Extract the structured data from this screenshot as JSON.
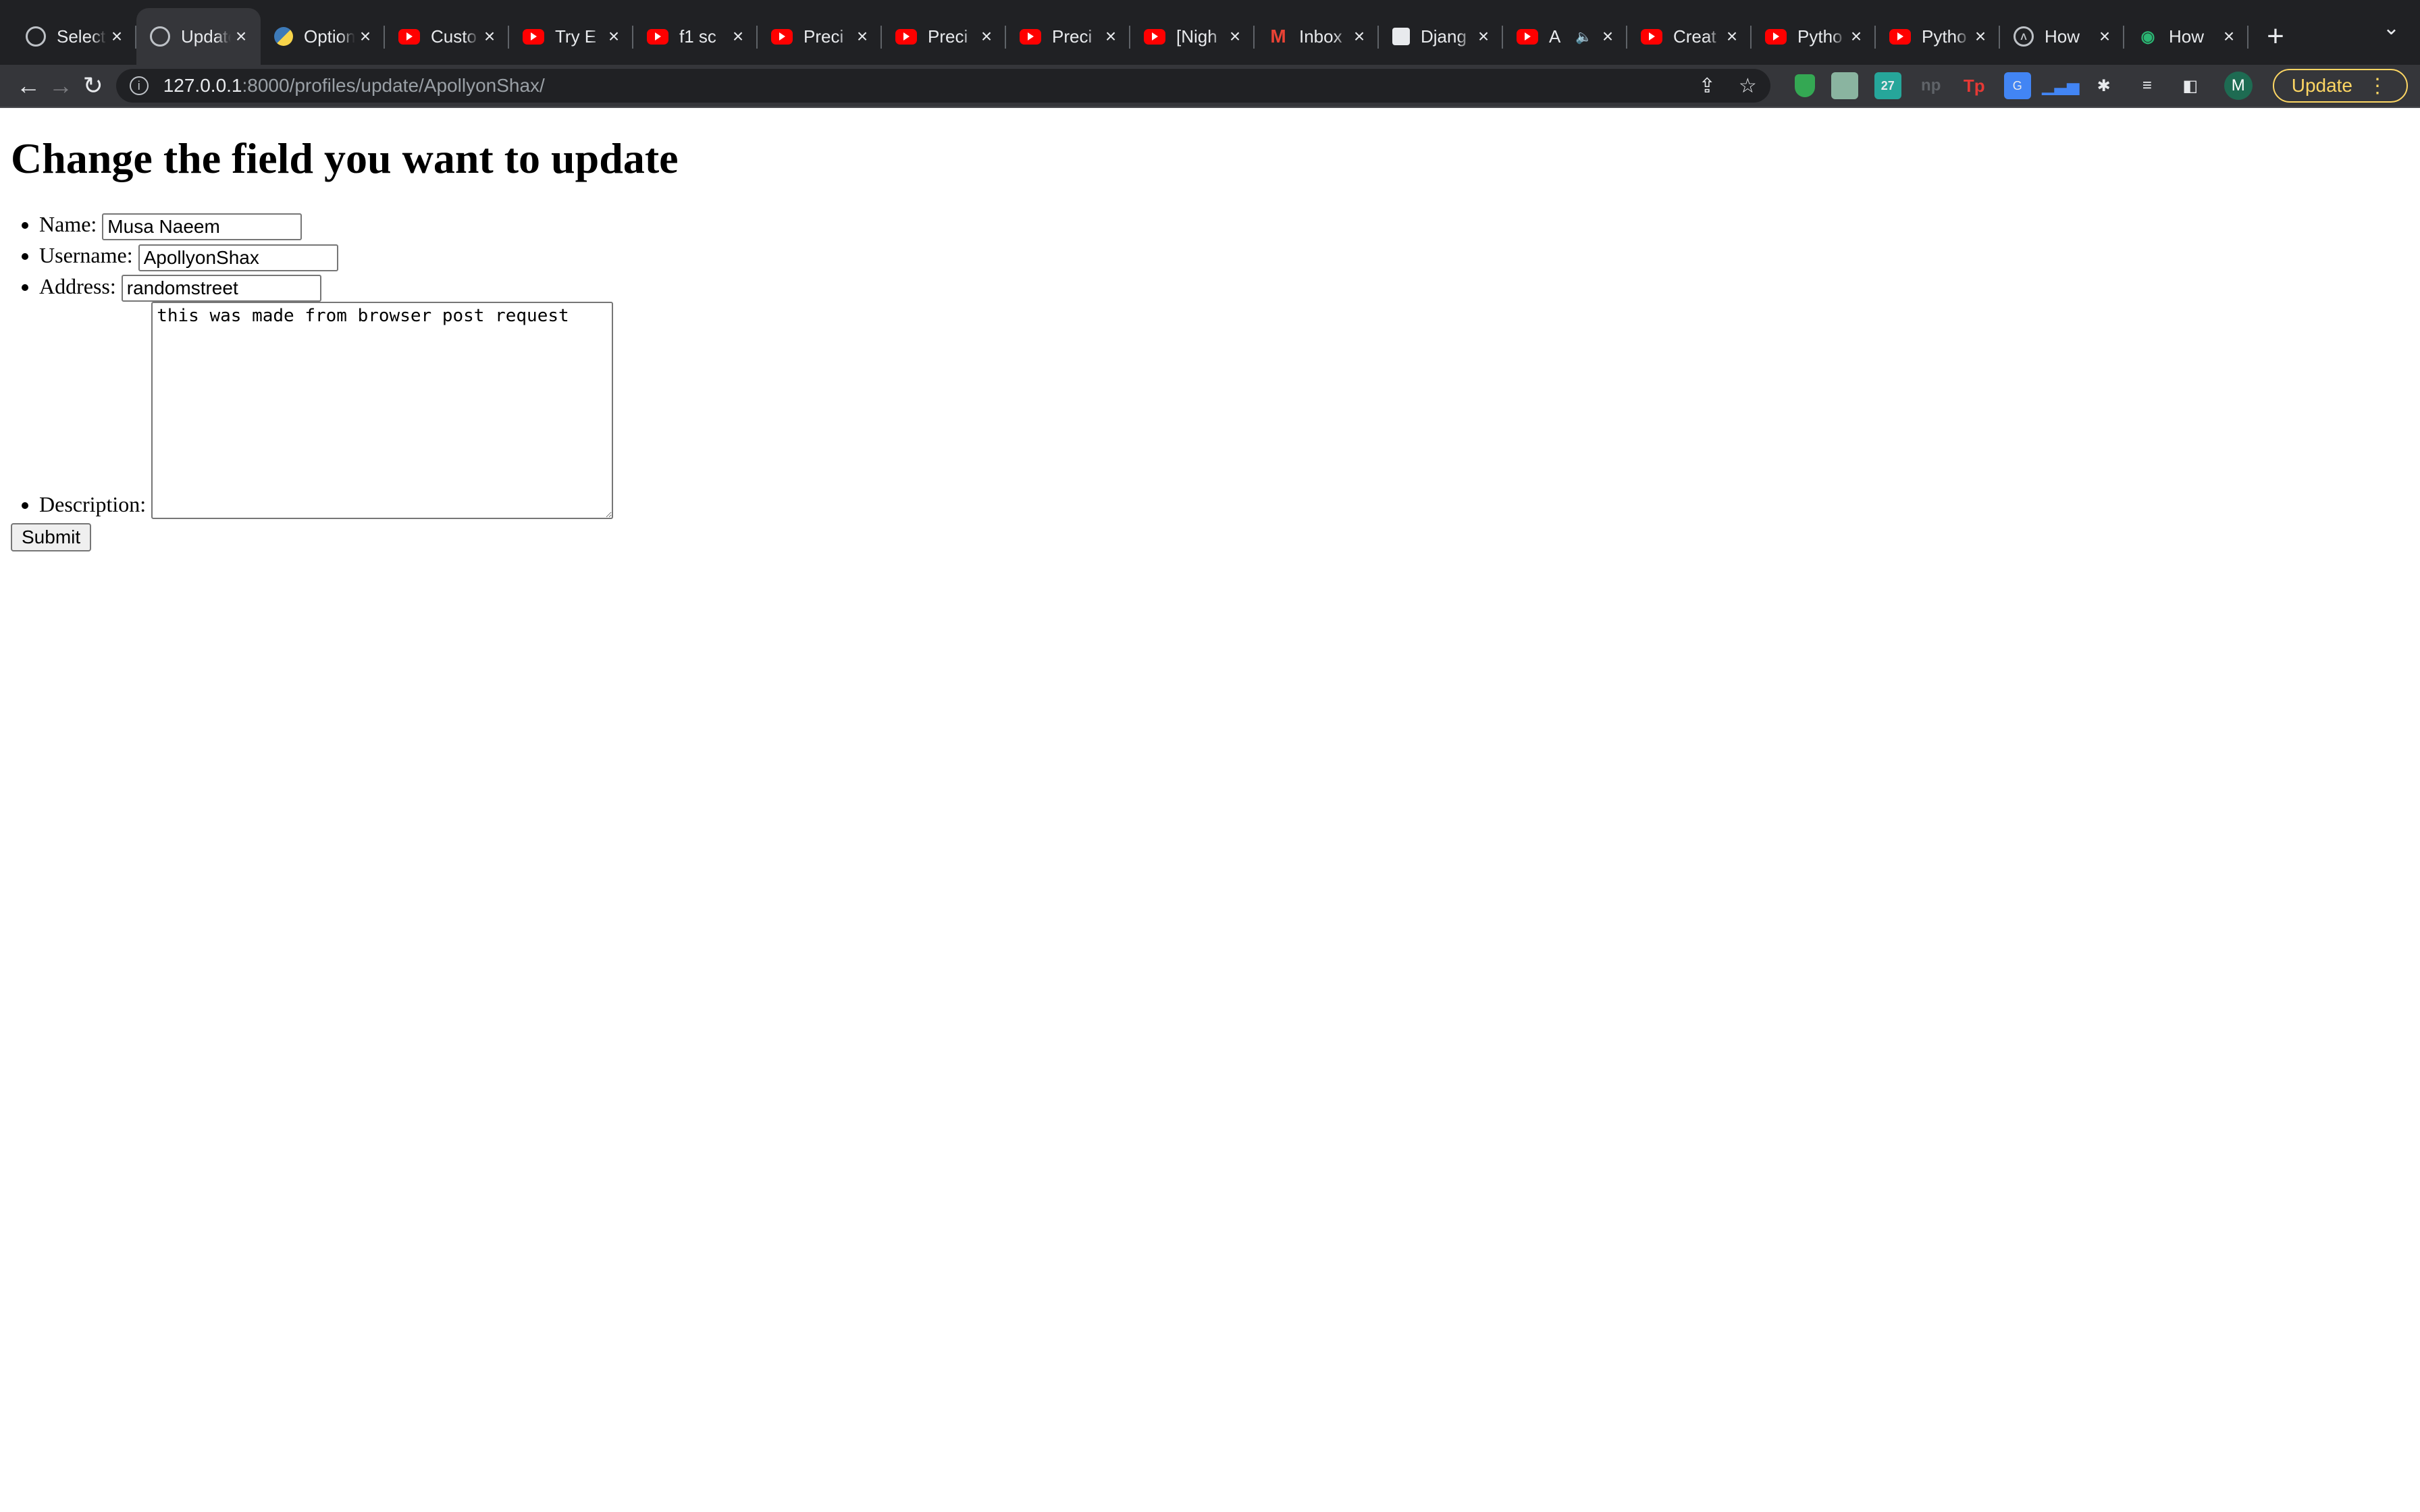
{
  "browser": {
    "tabs": [
      {
        "icon": "globe-icon",
        "title": "Select",
        "active": false
      },
      {
        "icon": "globe-icon",
        "title": "Update",
        "active": true
      },
      {
        "icon": "python-icon",
        "title": "Option",
        "active": false
      },
      {
        "icon": "youtube-icon",
        "title": "Custo",
        "active": false
      },
      {
        "icon": "youtube-icon",
        "title": "Try E",
        "active": false
      },
      {
        "icon": "youtube-icon",
        "title": "f1 sc",
        "active": false
      },
      {
        "icon": "youtube-icon",
        "title": "Preci",
        "active": false
      },
      {
        "icon": "youtube-icon",
        "title": "Preci",
        "active": false
      },
      {
        "icon": "youtube-icon",
        "title": "Preci",
        "active": false
      },
      {
        "icon": "youtube-icon",
        "title": "[Nigh",
        "active": false
      },
      {
        "icon": "gmail-icon",
        "title": "Inbox",
        "active": false
      },
      {
        "icon": "trello-icon",
        "title": "Djang",
        "active": false
      },
      {
        "icon": "youtube-icon",
        "title": "A",
        "active": false,
        "audio": true
      },
      {
        "icon": "youtube-icon",
        "title": "Creat",
        "active": false
      },
      {
        "icon": "youtube-icon",
        "title": "Pytho",
        "active": false
      },
      {
        "icon": "youtube-icon",
        "title": "Pytho",
        "active": false
      },
      {
        "icon": "chevron-circle-icon",
        "title": "How",
        "active": false
      },
      {
        "icon": "eye-icon",
        "title": "How",
        "active": false
      }
    ],
    "url_host": "127.0.0.1",
    "url_path": ":8000/profiles/update/ApollyonShax/",
    "avatar_letter": "M",
    "update_label": "Update"
  },
  "page": {
    "heading": "Change the field you want to update",
    "fields": {
      "name_label": "Name:",
      "name_value": "Musa Naeem",
      "username_label": "Username:",
      "username_value": "ApollyonShax",
      "address_label": "Address:",
      "address_value": "randomstreet",
      "description_label": "Description:",
      "description_value": "this was made from browser post request"
    },
    "submit_label": "Submit"
  }
}
